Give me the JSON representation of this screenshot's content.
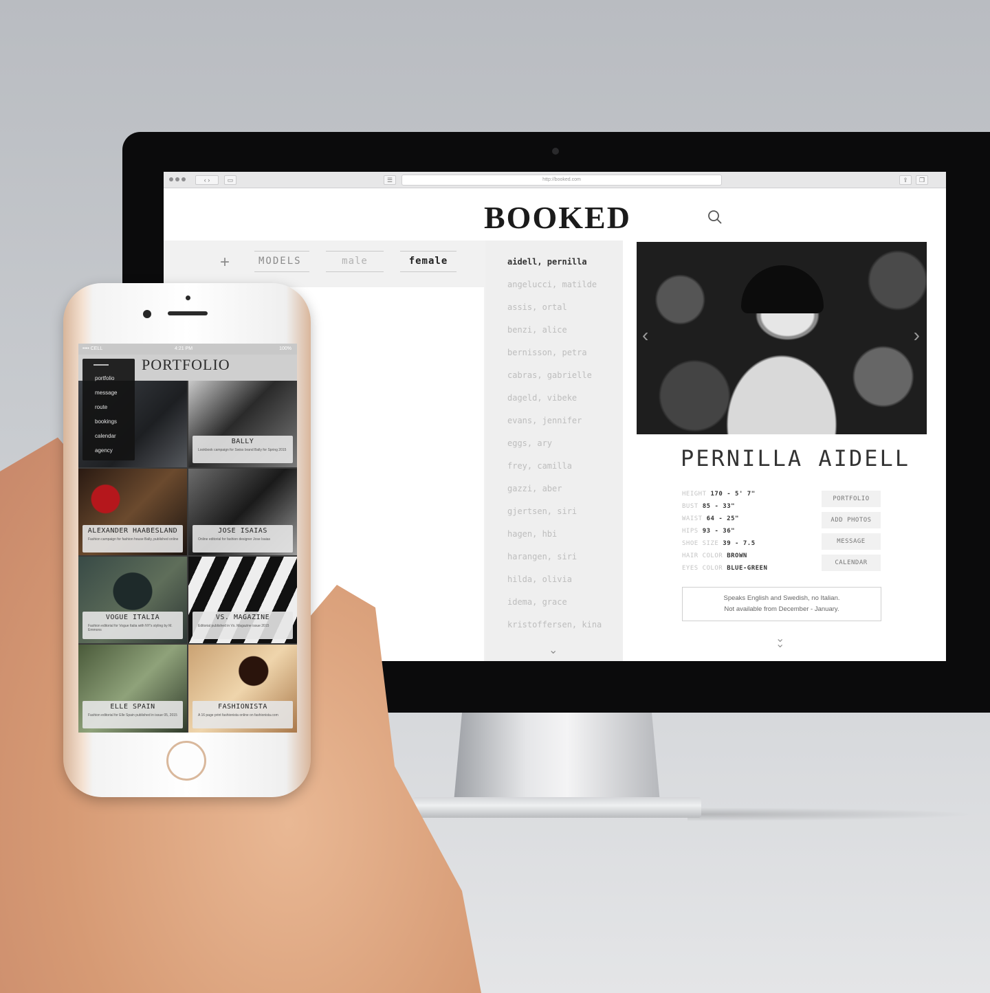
{
  "browser": {
    "url": "http://booked.com",
    "menu_label": "☰"
  },
  "site": {
    "brand": "BOOKED"
  },
  "filters": {
    "add_label": "+",
    "models_label": "MODELS",
    "male_label": "male",
    "female_label": "female"
  },
  "model_list": [
    "aidell, pernilla",
    "angelucci, matilde",
    "assis, ortal",
    "benzi, alice",
    "bernisson, petra",
    "cabras, gabrielle",
    "dageld, vibeke",
    "evans, jennifer",
    "eggs, ary",
    "frey, camilla",
    "gazzi, aber",
    "gjertsen, siri",
    "hagen, hbi",
    "harangen, siri",
    "hilda, olivia",
    "idema, grace",
    "kristoffersen, kina"
  ],
  "profile": {
    "name": "PERNILLA AIDELL",
    "stats": [
      {
        "label": "HEIGHT",
        "value": "170 - 5' 7\""
      },
      {
        "label": "BUST",
        "value": "85 - 33\""
      },
      {
        "label": "WAIST",
        "value": "64 - 25\""
      },
      {
        "label": "HIPS",
        "value": "93 - 36\""
      },
      {
        "label": "SHOE SIZE",
        "value": "39 - 7.5"
      },
      {
        "label": "HAIR COLOR",
        "value": "BROWN"
      },
      {
        "label": "EYES COLOR",
        "value": "BLUE-GREEN"
      }
    ],
    "buttons": [
      "PORTFOLIO",
      "ADD PHOTOS",
      "MESSAGE",
      "CALENDAR"
    ],
    "note_line1": "Speaks English and Swedish, no Italian.",
    "note_line2": "Not available from December - January."
  },
  "phone": {
    "status_carrier": "•••• CELL",
    "status_time": "4:21 PM",
    "status_battery": "100%",
    "title": "PORTFOLIO",
    "menu": [
      "portfolio",
      "message",
      "route",
      "bookings",
      "calendar",
      "agency"
    ],
    "tiles": [
      {
        "title": "",
        "desc": ""
      },
      {
        "title": "BALLY",
        "desc": "Lookbook campaign for Swiss brand Bally for Spring 2015"
      },
      {
        "title": "ALEXANDER HAABESLAND",
        "desc": "Fashion campaign for fashion house Bally, published online"
      },
      {
        "title": "JOSE ISAIAS",
        "desc": "Online editorial for fashion designer Jose Isaias"
      },
      {
        "title": "VOGUE ITALIA",
        "desc": "Fashion editorial for Vogue Italia with NY's styling by M. Emmons"
      },
      {
        "title": "VS. MAGAZINE",
        "desc": "Editorial published in Vs. Magazine issue 2015"
      },
      {
        "title": "ELLE SPAIN",
        "desc": "Fashion editorial for Elle Spain published in issue 05, 2015"
      },
      {
        "title": "FASHIONISTA",
        "desc": "A 16 page print fashionista online on fashionista.com"
      }
    ]
  },
  "colors": {
    "screen_bg": "#ffffff",
    "panel_gray": "#f1f1f1",
    "text_dark": "#333333",
    "text_muted": "#bdbdbd",
    "phone_gold": "#d9b89c"
  },
  "icons": {
    "search": "search-icon",
    "list_down": "chevron-down-icon",
    "profile_down": "double-chevron-down-icon",
    "photo_prev": "chevron-left-icon",
    "photo_next": "chevron-right-icon"
  }
}
